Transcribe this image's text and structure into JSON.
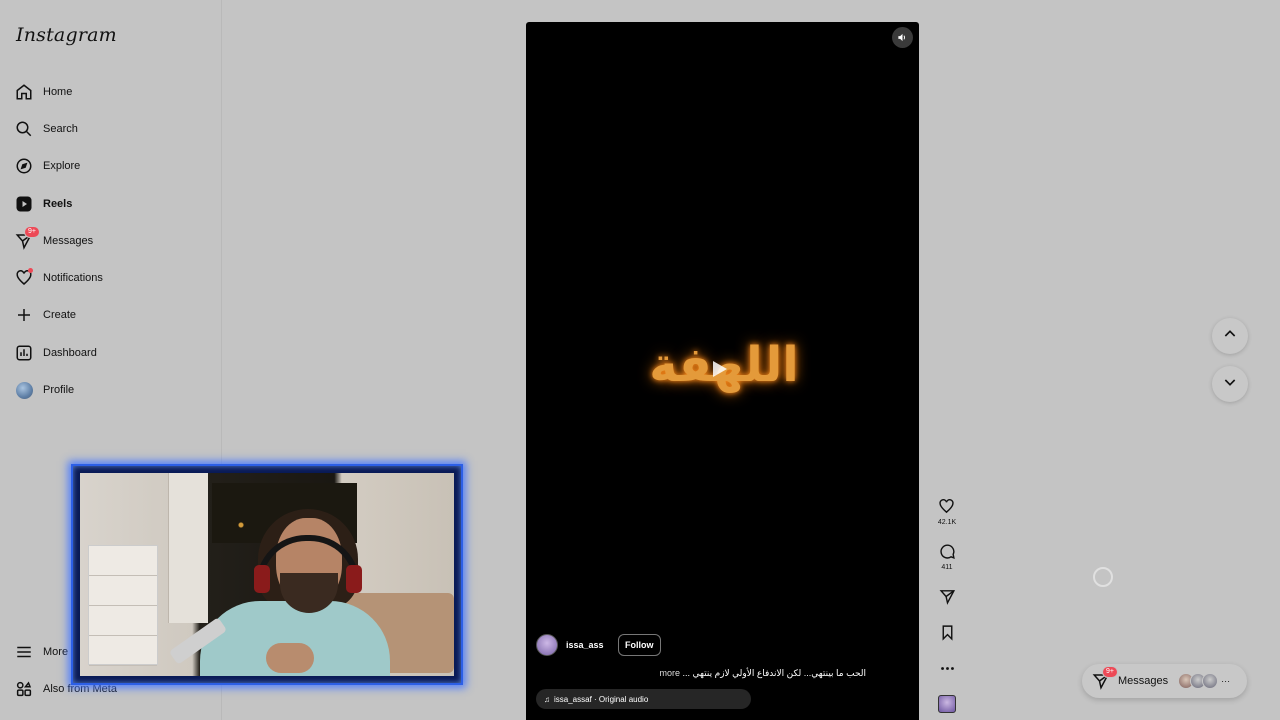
{
  "app": {
    "logo": "Instagram"
  },
  "sidebar": {
    "items": [
      {
        "label": "Home",
        "icon": "home-icon"
      },
      {
        "label": "Search",
        "icon": "search-icon"
      },
      {
        "label": "Explore",
        "icon": "compass-icon"
      },
      {
        "label": "Reels",
        "icon": "reels-icon",
        "active": true
      },
      {
        "label": "Messages",
        "icon": "messenger-icon",
        "badge": "9+"
      },
      {
        "label": "Notifications",
        "icon": "heart-icon",
        "dot": true
      },
      {
        "label": "Create",
        "icon": "plus-icon"
      },
      {
        "label": "Dashboard",
        "icon": "dashboard-icon"
      },
      {
        "label": "Profile",
        "icon": "profile-avatar"
      }
    ],
    "bottom": [
      {
        "label": "More",
        "icon": "menu-icon"
      },
      {
        "label": "Also from Meta",
        "icon": "meta-apps-icon"
      }
    ]
  },
  "reel": {
    "title_art": "اللهفة",
    "author": "issa_ass",
    "follow_label": "Follow",
    "caption": "الحب ما بينتهي... لكن الاندفاع الأولي لازم ينتهي ...",
    "caption_more": "more",
    "audio": "issa_assaf · Original audio"
  },
  "actions": {
    "likes": "42.1K",
    "comments": "411"
  },
  "messages_pill": {
    "label": "Messages",
    "badge": "9+",
    "more": "···"
  },
  "colors": {
    "background": "#c4c4c4",
    "badge": "#ed4956",
    "webcam_border": "#2c5fe6",
    "title_glow": "#e49a3a"
  }
}
